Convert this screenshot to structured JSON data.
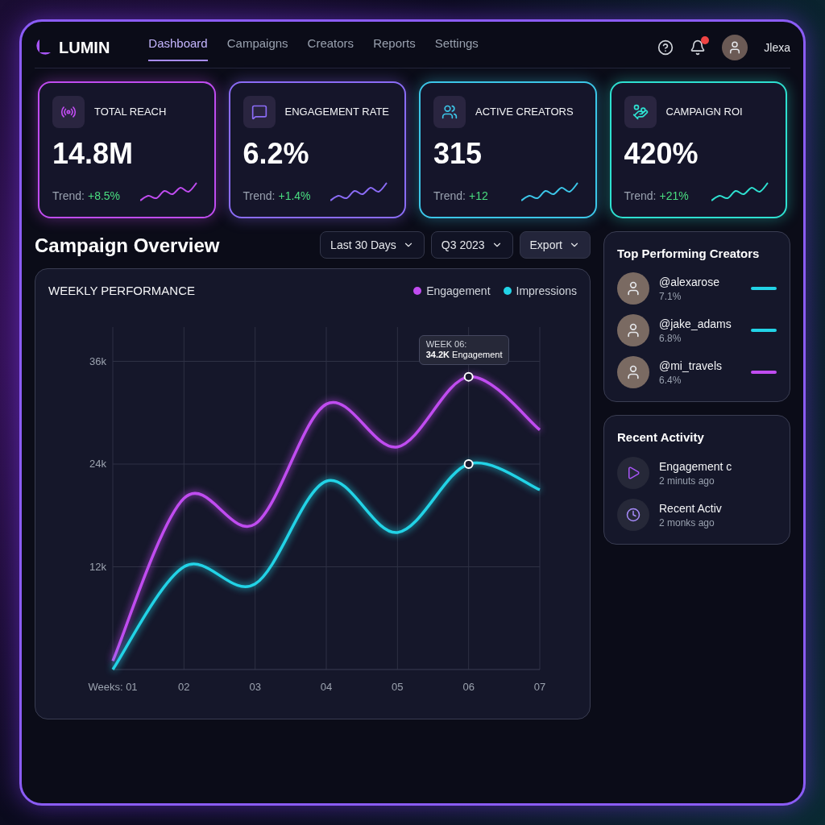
{
  "brand": {
    "name": "LUMIN"
  },
  "nav": {
    "tabs": [
      {
        "label": "Dashboard",
        "selected": true
      },
      {
        "label": "Campaigns",
        "selected": false
      },
      {
        "label": "Creators",
        "selected": false
      },
      {
        "label": "Reports",
        "selected": false
      },
      {
        "label": "Settings",
        "selected": false
      }
    ],
    "notifications": {
      "unread": true
    },
    "user": {
      "name": "Jlexa"
    }
  },
  "stats": [
    {
      "kind": "reach",
      "title": "TOTAL REACH",
      "value": "14.8M",
      "trend_label": "Trend:",
      "trend": "+8.5%",
      "color": "#c04cf0"
    },
    {
      "kind": "engagement",
      "title": "ENGAGEMENT RATE",
      "value": "6.2%",
      "trend_label": "Trend:",
      "trend": "+1.4%",
      "color": "#8b6cf6"
    },
    {
      "kind": "creators",
      "title": "ACTIVE CREATORS",
      "value": "315",
      "trend_label": "Trend:",
      "trend": "+12",
      "color": "#3cc6e8"
    },
    {
      "kind": "roi",
      "title": "CAMPAIGN ROI",
      "value": "420%",
      "trend_label": "Trend:",
      "trend": "+21%",
      "color": "#2ee0d0"
    }
  ],
  "overview": {
    "title": "Campaign Overview",
    "filters": [
      {
        "kind": "dropdown",
        "label": "Last 30 Days"
      },
      {
        "kind": "dropdown",
        "label": "Q3 2023"
      },
      {
        "kind": "button",
        "label": "Export"
      }
    ],
    "chart_title": "WEEKLY PERFORMANCE",
    "tooltip": {
      "title": "WEEK 06:",
      "value": "34.2K",
      "label": "Engagement"
    },
    "chart_data": {
      "type": "line",
      "categories": [
        "Weeks: 01",
        "02",
        "03",
        "04",
        "05",
        "06",
        "07"
      ],
      "series": [
        {
          "name": "Engagement",
          "color": "#c04cf0",
          "values": [
            1,
            20,
            17,
            31,
            26,
            34.2,
            28
          ]
        },
        {
          "name": "Impressions",
          "color": "#22d3e6",
          "values": [
            0,
            12,
            10,
            22,
            16,
            24,
            21
          ]
        }
      ],
      "ylim": [
        0,
        40
      ],
      "grid": true,
      "yticks": [
        {
          "value": 12,
          "label": "12k"
        },
        {
          "value": 24,
          "label": "24k"
        },
        {
          "value": 36,
          "label": "36k"
        }
      ]
    }
  },
  "top_creators": {
    "title": "Top Performing Creators",
    "items": [
      {
        "handle": "@alexarose",
        "rate": "7.1%",
        "color": "#22d3e6"
      },
      {
        "handle": "@jake_adams",
        "rate": "6.8%",
        "color": "#22d3e6"
      },
      {
        "handle": "@mi_travels",
        "rate": "6.4%",
        "color": "#c04cf0"
      }
    ]
  },
  "activity": {
    "title": "Recent Activity",
    "items": [
      {
        "kind": "play",
        "text": "Engagement c",
        "time": "2 minuts ago"
      },
      {
        "kind": "clock",
        "text": "Recent Activ",
        "time": "2 monks ago"
      }
    ]
  }
}
